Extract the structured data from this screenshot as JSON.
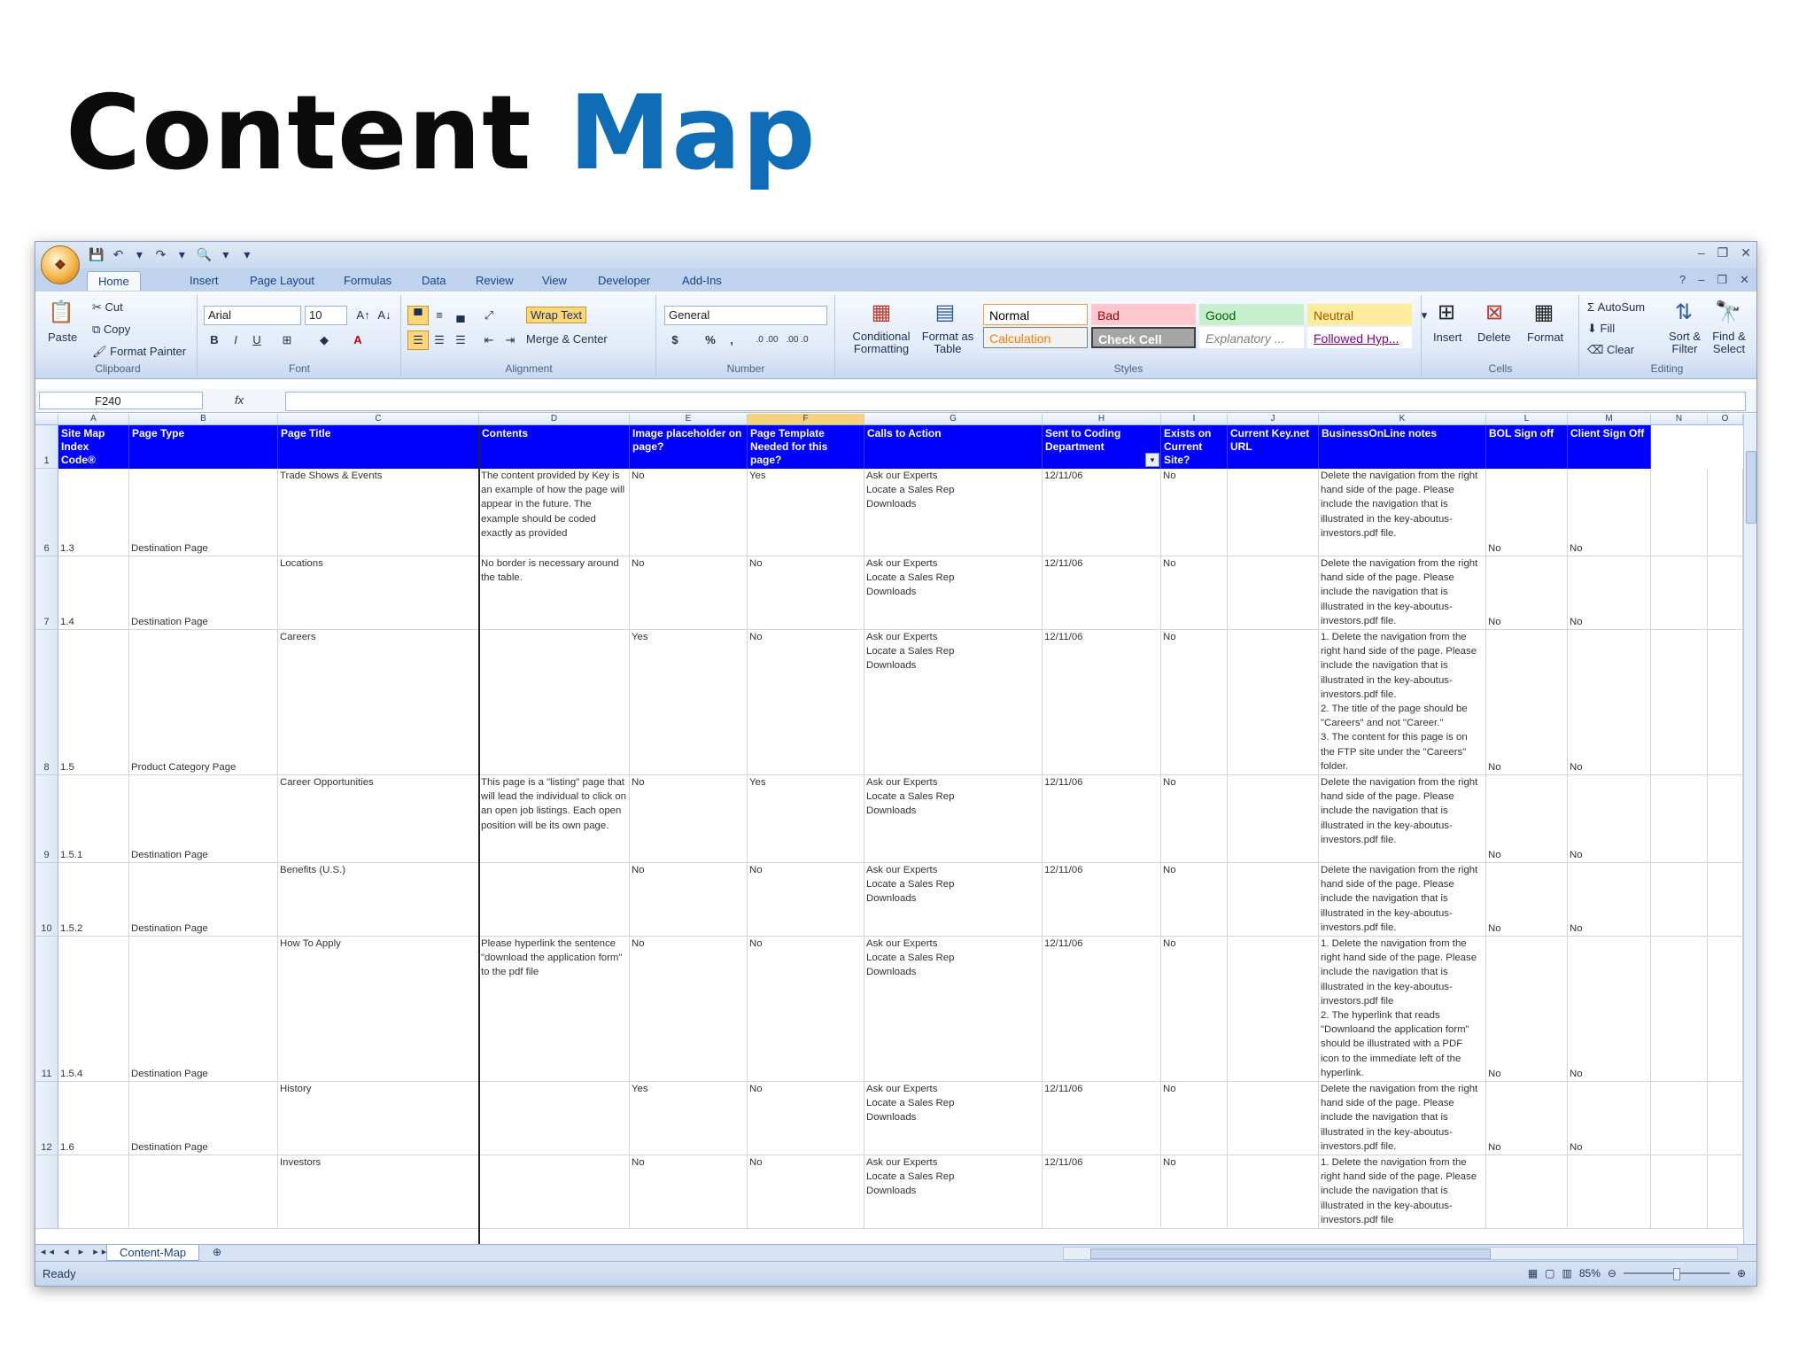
{
  "slide": {
    "title_part1": "Content",
    "title_part2": "Map"
  },
  "excel": {
    "office_button": "❖",
    "qat": [
      "💾",
      "↶",
      "▾",
      "↷",
      "▾",
      "🔍",
      "▾",
      "▾"
    ],
    "window_controls": [
      "–",
      "❐",
      "✕"
    ],
    "tabs": [
      "Home",
      "Insert",
      "Page Layout",
      "Formulas",
      "Data",
      "Review",
      "View",
      "Developer",
      "Add-Ins"
    ],
    "ribbon": {
      "clipboard": {
        "label": "Clipboard",
        "paste": "Paste",
        "cut": "Cut",
        "copy": "Copy",
        "format_painter": "Format Painter"
      },
      "font": {
        "label": "Font",
        "name": "Arial",
        "size": "10",
        "bold": "B",
        "italic": "I",
        "underline": "U"
      },
      "alignment": {
        "label": "Alignment",
        "wrap_text": "Wrap Text",
        "merge_center": "Merge & Center"
      },
      "number": {
        "label": "Number",
        "format": "General",
        "currency": "$",
        "percent": "%",
        "comma": ",",
        "inc_dec": ".0 .00",
        "dec_dec": ".00 .0"
      },
      "styles": {
        "label": "Styles",
        "conditional": "Conditional Formatting",
        "format_table": "Format as Table",
        "cells": [
          {
            "text": "Normal",
            "bg": "#ffffff",
            "fg": "#000000",
            "border": "#f29b3a"
          },
          {
            "text": "Bad",
            "bg": "#ffc7ce",
            "fg": "#9c0006",
            "border": "#ffc7ce"
          },
          {
            "text": "Good",
            "bg": "#c6efce",
            "fg": "#006100",
            "border": "#c6efce"
          },
          {
            "text": "Neutral",
            "bg": "#ffeb9c",
            "fg": "#9c5700",
            "border": "#ffeb9c"
          },
          {
            "text": "Calculation",
            "bg": "#f2f2f2",
            "fg": "#fa7d00",
            "border": "#7f7f7f"
          },
          {
            "text": "Check Cell",
            "bg": "#a5a5a5",
            "fg": "#ffffff",
            "border": "#3f3f3f"
          },
          {
            "text": "Explanatory ...",
            "bg": "#ffffff",
            "fg": "#7f7f7f",
            "border": "#ffffff"
          },
          {
            "text": "Followed Hyp...",
            "bg": "#ffffff",
            "fg": "#800080",
            "border": "#ffffff"
          }
        ]
      },
      "cells": {
        "label": "Cells",
        "insert": "Insert",
        "delete": "Delete",
        "format": "Format"
      },
      "editing": {
        "label": "Editing",
        "autosum": "AutoSum",
        "fill": "Fill",
        "clear": "Clear",
        "sort_filter": "Sort & Filter",
        "find_select": "Find & Select"
      }
    },
    "name_box": "F240",
    "fx": "fx",
    "column_letters": [
      "A",
      "B",
      "C",
      "D",
      "E",
      "F",
      "G",
      "H",
      "I",
      "J",
      "K",
      "L",
      "M",
      "N",
      "O"
    ],
    "headers": [
      "Site Map Index Code®",
      "Page Type",
      "Page Title",
      "Contents",
      "Image placeholder on page?",
      "Page Template Needed for this page?",
      "Calls to Action",
      "Sent to Coding Department",
      "Exists on Current Site?",
      "Current Key.net URL",
      "BusinessOnLine notes",
      "BOL Sign off",
      "Client Sign Off"
    ],
    "header_row_number": "1",
    "rows": [
      {
        "row": "6",
        "a": "1.3",
        "b": "Destination Page",
        "c": "Trade Shows & Events",
        "d": "The content provided by Key is an example of how the page will appear in the future.  The example should be coded exactly as provided",
        "e": "No",
        "f": "Yes",
        "g": "Ask our Experts\nLocate a Sales Rep\nDownloads",
        "h": "12/11/06",
        "i": "No",
        "k": "Delete the navigation from the right hand side of the page. Please include the navigation that is illustrated in the key-aboutus-investors.pdf file.",
        "l": "No",
        "m": "No"
      },
      {
        "row": "7",
        "a": "1.4",
        "b": "Destination Page",
        "c": "Locations",
        "d": "No border is necessary around the table.",
        "e": "No",
        "f": "No",
        "g": "Ask our Experts\nLocate a Sales Rep\nDownloads",
        "h": "12/11/06",
        "i": "No",
        "k": "Delete the navigation from the right hand side of the page. Please include the navigation that is illustrated in the key-aboutus-investors.pdf file.",
        "l": "No",
        "m": "No"
      },
      {
        "row": "8",
        "a": "1.5",
        "b": "Product Category Page",
        "c": "Careers",
        "d": "",
        "e": "Yes",
        "f": "No",
        "g": "Ask our Experts\nLocate a Sales Rep\nDownloads",
        "h": "12/11/06",
        "i": "No",
        "k": "1. Delete the navigation from the right hand side of the page. Please include the navigation that is illustrated in the key-aboutus-investors.pdf file.\n2. The title of the page should be \"Careers\" and not \"Career.\"\n3. The content for this page is on the FTP site under the \"Careers\" folder.",
        "l": "No",
        "m": "No"
      },
      {
        "row": "9",
        "a": "1.5.1",
        "b": "Destination Page",
        "c": "Career Opportunities",
        "d": "This page is a \"listing\" page that will lead the individual to click on an open job listings. Each open position will be its own page.",
        "e": "No",
        "f": "Yes",
        "g": "Ask our Experts\nLocate a Sales Rep\nDownloads",
        "h": "12/11/06",
        "i": "No",
        "k": "Delete the navigation from the right hand side of the page. Please include the navigation that is illustrated in the key-aboutus-investors.pdf file.",
        "l": "No",
        "m": "No"
      },
      {
        "row": "10",
        "a": "1.5.2",
        "b": "Destination Page",
        "c": "Benefits (U.S.)",
        "d": "",
        "e": "No",
        "f": "No",
        "g": "Ask our Experts\nLocate a Sales Rep\nDownloads",
        "h": "12/11/06",
        "i": "No",
        "k": "Delete the navigation from the right hand side of the page. Please include the navigation that is illustrated in the key-aboutus-investors.pdf file.",
        "l": "No",
        "m": "No"
      },
      {
        "row": "11",
        "a": "1.5.4",
        "b": "Destination Page",
        "c": "How To Apply",
        "d": "Please hyperlink the sentence \"download the application form\" to the pdf file",
        "e": "No",
        "f": "No",
        "g": "Ask our Experts\nLocate a Sales Rep\nDownloads",
        "h": "12/11/06",
        "i": "No",
        "k": "1. Delete the navigation from the right hand side of the page. Please include the navigation that is illustrated in the key-aboutus-investors.pdf file\n2. The hyperlink that reads \"Downloand the application form\" should be illustrated with a PDF icon to the immediate left of the hyperlink.",
        "l": "No",
        "m": "No"
      },
      {
        "row": "12",
        "a": "1.6",
        "b": "Destination Page",
        "c": "History",
        "d": "",
        "e": "Yes",
        "f": "No",
        "g": "Ask our Experts\nLocate a Sales Rep\nDownloads",
        "h": "12/11/06",
        "i": "No",
        "k": "Delete the navigation from the right hand side of the page. Please include the navigation that is illustrated in the key-aboutus-investors.pdf file.",
        "l": "No",
        "m": "No"
      },
      {
        "row": "",
        "a": "",
        "b": "",
        "c": "Investors",
        "d": "",
        "e": "No",
        "f": "No",
        "g": "Ask our Experts\nLocate a Sales Rep\nDownloads",
        "h": "12/11/06",
        "i": "No",
        "k": "1. Delete the navigation from the right hand side of the page. Please include the navigation that is illustrated in the key-aboutus-investors.pdf file",
        "l": "",
        "m": ""
      }
    ],
    "sheet_tab": "Content-Map",
    "sheet_nav": "◂◂ ◂ ▸ ▸▸",
    "status": "Ready",
    "zoom": "85%",
    "header_color": "#0000ff",
    "selected_column": "F"
  }
}
